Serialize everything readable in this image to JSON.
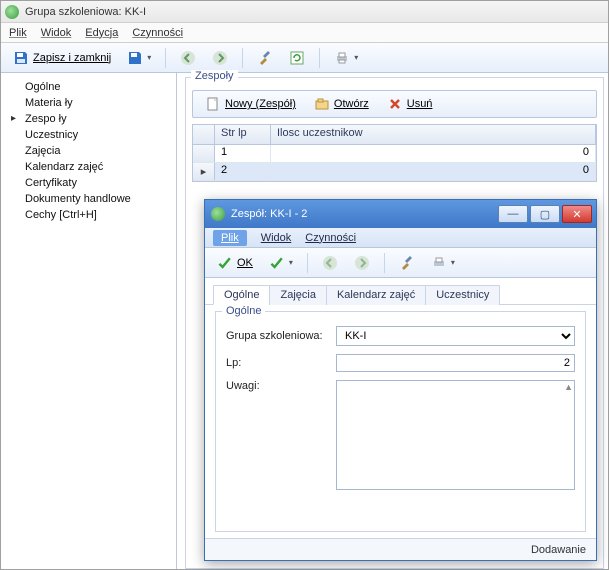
{
  "window": {
    "title": "Grupa szkoleniowa: KK-I"
  },
  "menu": {
    "plik": "Plik",
    "widok": "Widok",
    "edycja": "Edycja",
    "czynnosci": "Czynności"
  },
  "toolbar": {
    "save_close": "Zapisz i zamknij"
  },
  "sidebar": {
    "items": [
      {
        "label": "Ogólne"
      },
      {
        "label": "Materia ły"
      },
      {
        "label": "Zespo ły"
      },
      {
        "label": "Uczestnicy"
      },
      {
        "label": "Zajęcia"
      },
      {
        "label": "Kalendarz zajęć"
      },
      {
        "label": "Certyfikaty"
      },
      {
        "label": "Dokumenty handlowe"
      },
      {
        "label": "Cechy [Ctrl+H]"
      }
    ],
    "active_index": 2
  },
  "panel": {
    "group_label": "Zespoły",
    "actions": {
      "new": "Nowy (Zespół)",
      "open": "Otwórz",
      "delete": "Usuń"
    },
    "grid": {
      "cols": {
        "a": "Str lp",
        "b": "Ilosc uczestnikow"
      },
      "rows": [
        {
          "a": "1",
          "b": "0"
        },
        {
          "a": "2",
          "b": "0"
        }
      ]
    }
  },
  "dialog": {
    "title": "Zespół: KK-I - 2",
    "menu": {
      "plik": "Plik",
      "widok": "Widok",
      "czynnosci": "Czynności"
    },
    "toolbar": {
      "ok": "OK"
    },
    "tabs": [
      {
        "label": "Ogólne"
      },
      {
        "label": "Zajęcia"
      },
      {
        "label": "Kalendarz zajęć"
      },
      {
        "label": "Uczestnicy"
      }
    ],
    "group_label": "Ogólne",
    "form": {
      "grupa_label": "Grupa szkoleniowa:",
      "grupa_value": "KK-I",
      "lp_label": "Lp:",
      "lp_value": "2",
      "uwagi_label": "Uwagi:",
      "uwagi_value": ""
    },
    "footer": "Dodawanie"
  }
}
